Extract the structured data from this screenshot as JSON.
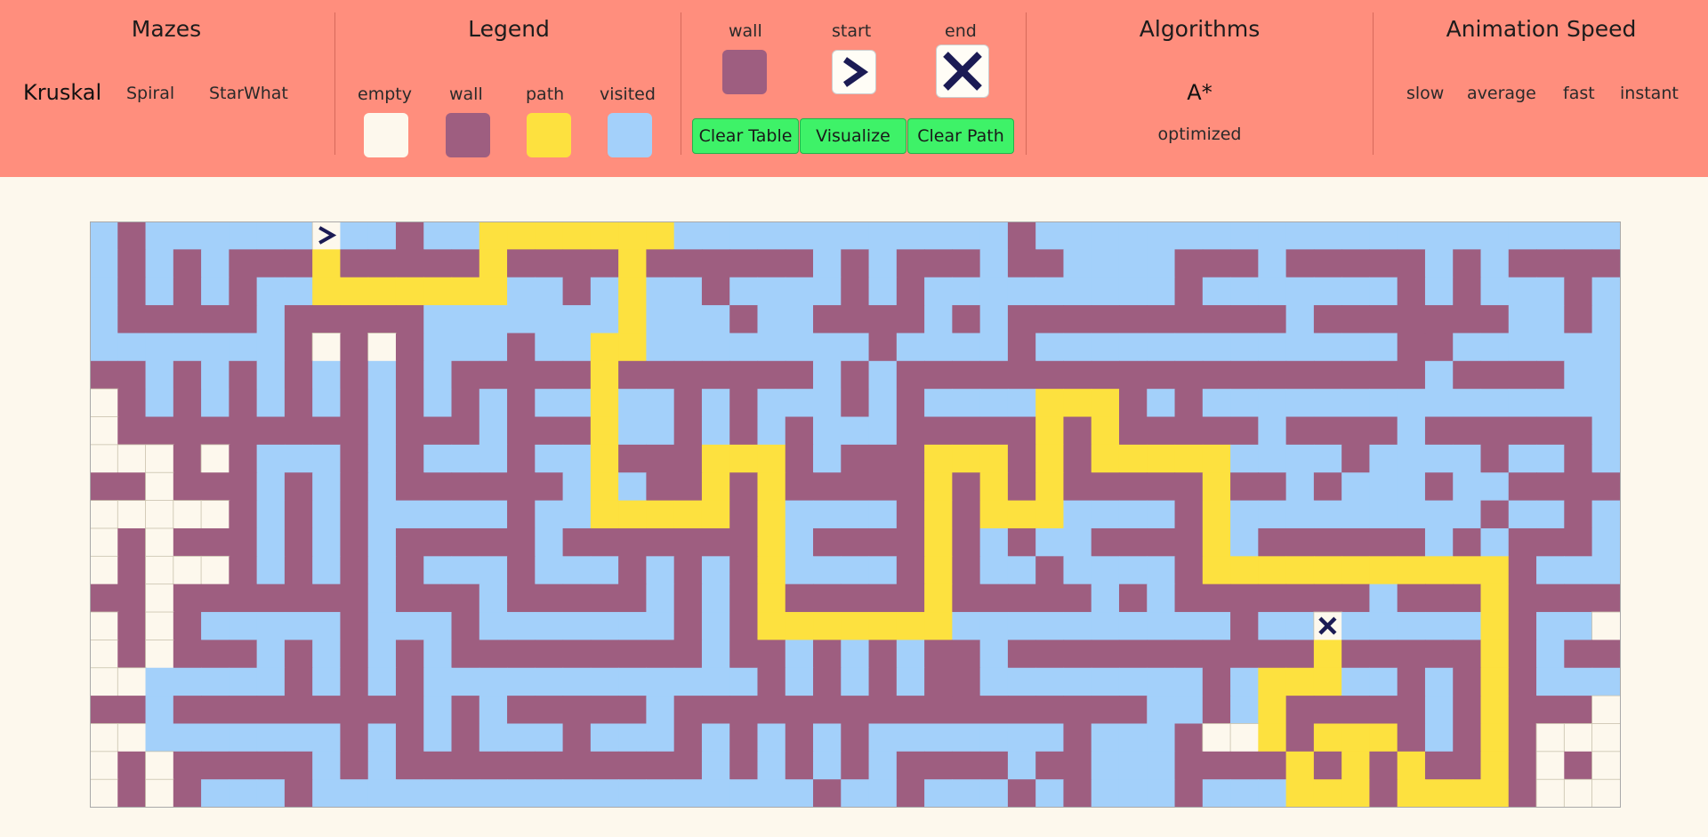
{
  "colors": {
    "empty": "#fdf8ed",
    "wall": "#9e5e80",
    "path": "#fde13f",
    "visited": "#a3d0fa",
    "topbar": "#ff8e7d",
    "button": "#3ef268",
    "icon": "#1b1b54"
  },
  "mazes": {
    "title": "Mazes",
    "options": [
      "Kruskal",
      "Spiral",
      "StarWhat"
    ]
  },
  "legend": {
    "title": "Legend",
    "items": [
      {
        "label": "empty"
      },
      {
        "label": "wall"
      },
      {
        "label": "path"
      },
      {
        "label": "visited"
      }
    ]
  },
  "nodes": {
    "wall_label": "wall",
    "start_label": "start",
    "end_label": "end"
  },
  "buttons": {
    "clear_table": "Clear Table",
    "visualize": "Visualize",
    "clear_path": "Clear Path"
  },
  "algorithms": {
    "title": "Algorithms",
    "selected": "A*",
    "option": "optimized"
  },
  "speed": {
    "title": "Animation Speed",
    "options": [
      "slow",
      "average",
      "fast",
      "instant"
    ]
  },
  "grid": {
    "start": {
      "row": 0,
      "col": 8
    },
    "end": {
      "row": 14,
      "col": 42
    },
    "rows": [
      "VWVVVVVVSVVWVVPPPPPPPVVVVVVVVVVVVWVVVVVVVVVVVVVVVVVVVVV",
      "VWVWVWWWPWWWWWPWWWWPWWWWWWVWVWWWVWWVVVVWWWVWWWWWVWVWWWW",
      "VWVWVWVVPPPPPPPVVWVPVVWVVVVWVWVVVVVVVVVWVVVVVVVWVWVVVWV",
      "VWWWWWVWWWWWVVVVVVVPVVVWVVWWWWVWVWWWWWWWWWWVWWWWWWWVVWV",
      "VVVVVVVWEWEWVVVWVVPPVVVVVVVVWVVVVWVVVVVVVVVVVVVWWVVVVVV",
      "WWVWVWVWVWVWVWWWWWPWWWWWWWVWVWWWWWWWWWWWWWWWWWWWVWWWWVV",
      "EWVWVWVWVWVWVWVWVVPVVWVWVVVWVWVVVVPPPWVWVVVVVVVVVVVVVVV",
      "EWWWWWWWWWVWWWVWWWPVVWVWVWVVVWWWWWPWPWWWWWVWWWWVWWWWWWV",
      "EEEWEWVVVWVWVVVWVVPWWWPPPWVWWWPPPWPWPPPPPVVVVWVVVVWVVWV",
      "WWEWWWVWVWVWWWWWWVPVWWPWPWWWWWPWPWPWWWWWPWWVWVVVWVVWWWW",
      "EEEEEWVWVWVVVVVWVVPPPPPWPVVVVWPWPPPVVVVWPVVVVVVVVVWVVWV",
      "EWEWWWVWVWVWWWWWVWWWWWWWPVWWWWPWVWVVWWWWPVWWWWWWVWVWWWV",
      "EWEEEWVWVWVWVVVWVVVWVWVWPVVVVWPWVVWVVVVWPPPPPPPPPPPWVVV",
      "WWEWWWWWWWVWWWVWWWWWVWVWPWWWWWPWWWWWVWVWWWWWWWVWWWPWWWW",
      "EWEWVVVVVWVVVWVVVVVVVWVWPPPPPPPVVVVVVVVVVWVVNVVVVVPWVVE",
      "EWEWWWVWVWVWVWWWWWWWWWVWWVWVWVWWVWWWWWWWWWWWPWWWWWPWVWW",
      "EEVVVVVWVWVWVVVVVVVVVVVVWVWVWVWWVVVVVVVVWVPPPVVWVWPWVVV",
      "WWVWWWWWWWWWVWVWWWWWVWWWWWWWWWWWWWWWWWVVWVPWWWWWVWPWWWE",
      "EEVVVVVVVWVWVWVVVWVVVWVWVWVWVVVVVVVWVVVWEEPWPPPWVWPWEEE",
      "EWEWWWWWVWVWWWWWWWWWWWVWVWVWVWWWWVWWVVVWWWWPWPWPWWPWEWE",
      "EWEWVVVWVVVVVVVVVVVVVVVVVVWVVWVVVWVWVVVWVVVPPPWPPPPWEEE"
    ]
  }
}
